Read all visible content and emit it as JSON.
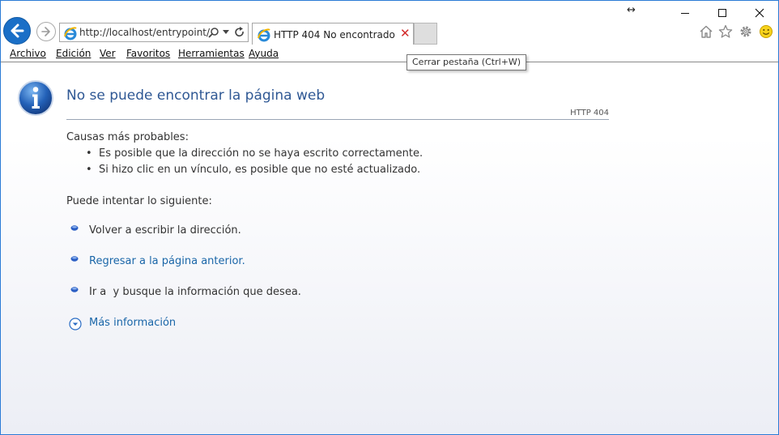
{
  "browser": {
    "address_url": "http://localhost/entrypoint/",
    "tab_title": "HTTP 404 No encontrado",
    "tab_close_glyph": "✕",
    "tooltip": "Cerrar pestaña (Ctrl+W)",
    "resize_glyph": "↔",
    "menu": [
      "Archivo",
      "Edición",
      "Ver",
      "Favoritos",
      "Herramientas",
      "Ayuda"
    ],
    "toolbar_icons": [
      "home-icon",
      "star-icon",
      "gear-icon",
      "smiley-icon"
    ]
  },
  "page": {
    "title": "No se puede encontrar la página web",
    "http_code": "HTTP 404",
    "causes_title": "Causas más probables:",
    "causes": [
      "Es posible que la dirección no se haya escrito correctamente.",
      "Si hizo clic en un vínculo, es posible que no esté actualizado."
    ],
    "try_title": "Puede intentar lo siguiente:",
    "options": [
      "Volver a escribir la dirección.",
      "Regresar a la página anterior.",
      "Ir a  y busque la información que desea."
    ],
    "more_info": "Más información"
  },
  "colors": {
    "accent": "#1a6fc7",
    "title": "#2f5894",
    "link": "#1a66a8",
    "close_x": "#d32a2a"
  }
}
